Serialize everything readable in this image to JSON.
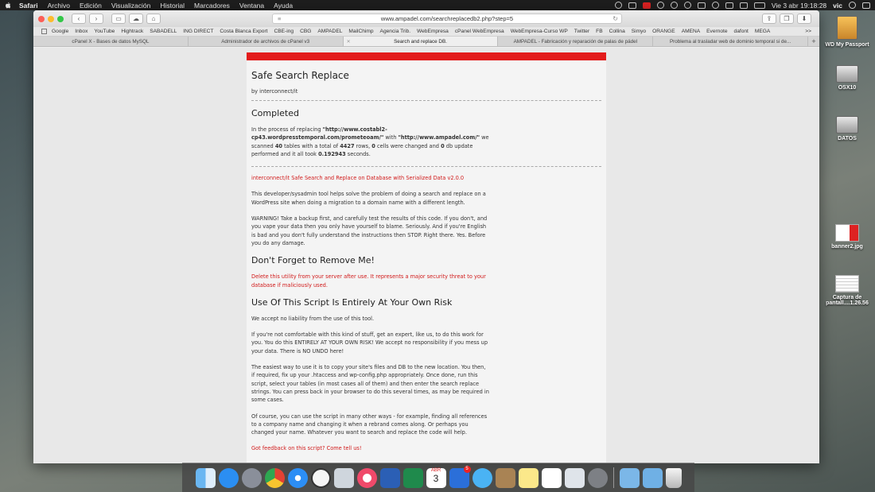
{
  "menubar": {
    "app": "Safari",
    "items": [
      "Archivo",
      "Edición",
      "Visualización",
      "Historial",
      "Marcadores",
      "Ventana",
      "Ayuda"
    ],
    "clock": "Vie 3 abr  19:18:28",
    "user": "vic"
  },
  "toolbar": {
    "url": "www.ampadel.com/searchreplacedb2.php?step=5"
  },
  "bookmarks": {
    "items": [
      "Google",
      "Inbox",
      "YouTube",
      "Hightrack",
      "SABADELL",
      "ING DIRECT",
      "Costa Blanca Export",
      "CBE-ing",
      "CBG",
      "AMPADEL",
      "MailChimp",
      "Agencia Trib.",
      "WebEmpresa",
      "cPanel WebEmpresa",
      "WebEmpresa-Curso WP",
      "Twitter",
      "FB",
      "Collina",
      "Simyo",
      "ORANGE",
      "AMENA",
      "Evernote",
      "dafont",
      "MEGA"
    ],
    "more": ">>"
  },
  "tabs": [
    "cPanel X - Bases de datos MySQL",
    "Administrador de archivos de cPanel v3",
    "Search and replace DB.",
    "AMPADEL - Fabricación y reparación de palas de pádel",
    "Problema al trasladar web de dominio temporal si de..."
  ],
  "page": {
    "title": "Safe Search Replace",
    "byline": "by interconnect/it",
    "completed_heading": "Completed",
    "completed": {
      "t1": "In the process of replacing ",
      "from": "\"http://www.costabl2-cp43.wordpresstemporal.com/prometeoam/\"",
      "t2": " with ",
      "to": "\"http://www.ampadel.com/\"",
      "t3": " we scanned ",
      "tables": "40",
      "t4": " tables with a total of ",
      "rows": "4427",
      "t5": " rows, ",
      "cells": "0",
      "t6": " cells were changed and ",
      "db": "0",
      "t7": " db update performed and it all took ",
      "secs": "0.192943",
      "t8": " seconds."
    },
    "tool_name": "interconnect/it Safe Search and Replace on Database with Serialized Data v2.0.0",
    "intro": "This developer/sysadmin tool helps solve the problem of doing a search and replace on a WordPress site when doing a migration to a domain name with a different length.",
    "warning": "WARNING! Take a backup first, and carefully test the results of this code. If you don't, and you vape your data then you only have yourself to blame. Seriously. And if you're English is bad and you don't fully understand the instructions then STOP. Right there. Yes. Before you do any damage.",
    "remove_heading": "Don't Forget to Remove Me!",
    "remove_text": "Delete this utility from your server after use. It represents a major security threat to your database if maliciously used.",
    "risk_heading": "Use Of This Script Is Entirely At Your Own Risk",
    "risk_p1": "We accept no liability from the use of this tool.",
    "risk_p2": "If you're not comfortable with this kind of stuff, get an expert, like us, to do this work for you. You do this ENTIRELY AT YOUR OWN RISK! We accept no responsibility if you mess up your data. There is NO UNDO here!",
    "risk_p3": "The easiest way to use it is to copy your site's files and DB to the new location. You then, if required, fix up your .htaccess and wp-config.php appropriately. Once done, run this script, select your tables (in most cases all of them) and then enter the search replace strings. You can press back in your browser to do this several times, as may be required in some cases.",
    "risk_p4": "Of course, you can use the script in many other ways - for example, finding all references to a company name and changing it when a rebrand comes along. Or perhaps you changed your name. Whatever you want to search and replace the code will help.",
    "feedback": "Got feedback on this script? Come tell us!"
  },
  "desktop": {
    "items": [
      "WD My Passport",
      "OSX10",
      "DATOS",
      "banner2.jpg",
      "Captura de pantall....1.26.56"
    ]
  },
  "dock": {
    "calendar_month": "ABR",
    "calendar_day": "3",
    "badge": "5",
    "items": [
      "finder-icon",
      "app-store-icon",
      "launchpad-icon",
      "chrome-icon",
      "safari-icon",
      "clock-icon",
      "preview-icon",
      "itunes-icon",
      "word-icon",
      "excel-icon",
      "calendar-icon",
      "wunderlist-icon",
      "messages-icon",
      "notes-icon",
      "stickies-icon",
      "reminders-icon",
      "photos-icon",
      "preferences-icon",
      "applications-folder-icon",
      "downloads-folder-icon",
      "trash-icon"
    ]
  }
}
